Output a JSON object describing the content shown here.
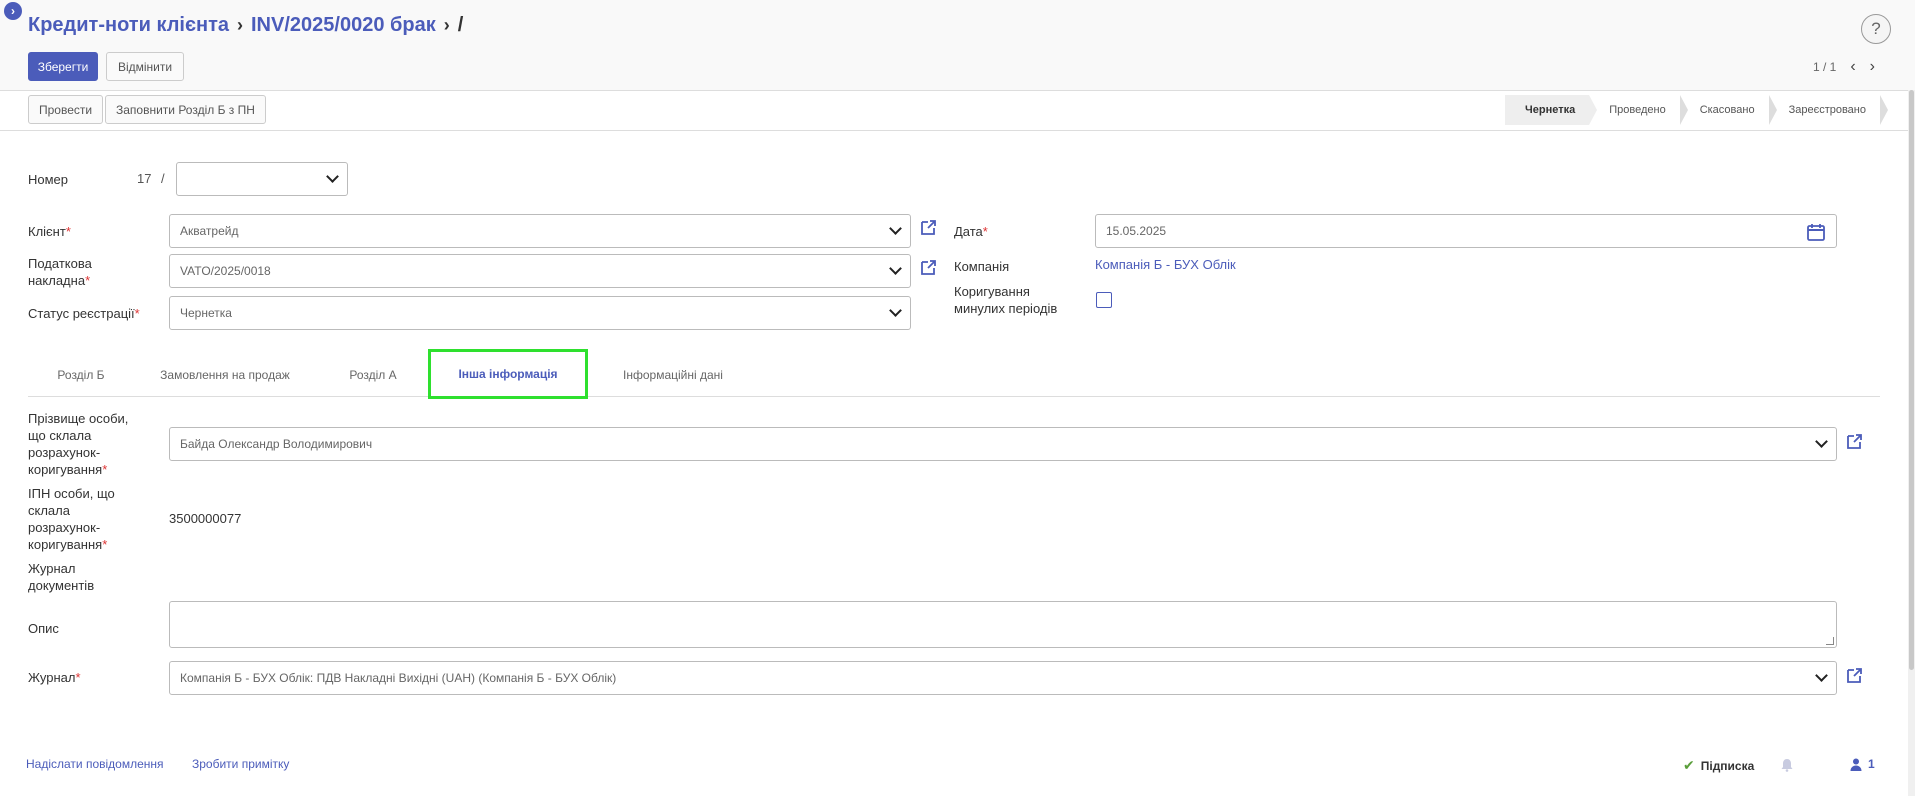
{
  "breadcrumb": {
    "root": "Кредит-ноти клієнта",
    "record": "INV/2025/0020 брак",
    "current": "/"
  },
  "help": "?",
  "toolbar": {
    "save": "Зберегти",
    "discard": "Відмінити"
  },
  "pager": {
    "value": "1 / 1"
  },
  "actions": {
    "post": "Провести",
    "fill": "Заповнити Розділ Б з ПН"
  },
  "states": [
    "Чернетка",
    "Проведено",
    "Скасовано",
    "Зареєстровано"
  ],
  "form": {
    "number_label": "Номер",
    "number_value": "17",
    "number_sep": "/",
    "client_label": "Клієнт",
    "client_value": "Акватрейд",
    "tax_invoice_label": "Податкова накладна",
    "tax_invoice_value": "VATO/2025/0018",
    "reg_status_label": "Статус реєстрації",
    "reg_status_value": "Чернетка",
    "date_label": "Дата",
    "date_value": "15.05.2025",
    "company_label": "Компанія",
    "company_value": "Компанія Б - БУХ Облік",
    "prev_period_label": "Коригування минулих періодів",
    "required_mark": "*"
  },
  "tabs": [
    "Розділ Б",
    "Замовлення на продаж",
    "Розділ А",
    "Інша інформація",
    "Інформаційні дані"
  ],
  "other_info": {
    "author_label": "Прізвище особи, що склала розрахунок-коригування",
    "author_value": "Байда  Олександр  Володимирович",
    "tin_label": "ІПН особи, що склала розрахунок-коригування",
    "tin_value": "3500000077",
    "doc_journal_label": "Журнал документів",
    "description_label": "Опис",
    "journal_label": "Журнал",
    "journal_value": "Компанія Б - БУХ Облік: ПДВ Накладні Вихідні (UAH) (Компанія Б - БУХ Облік)"
  },
  "chatter": {
    "send_message": "Надіслати повідомлення",
    "log_note": "Зробити примітку",
    "subscribe": "Підписка",
    "followers": "1"
  },
  "colors": {
    "accent": "#4b5cba",
    "highlight": "#2ee02e",
    "required": "#d33"
  }
}
